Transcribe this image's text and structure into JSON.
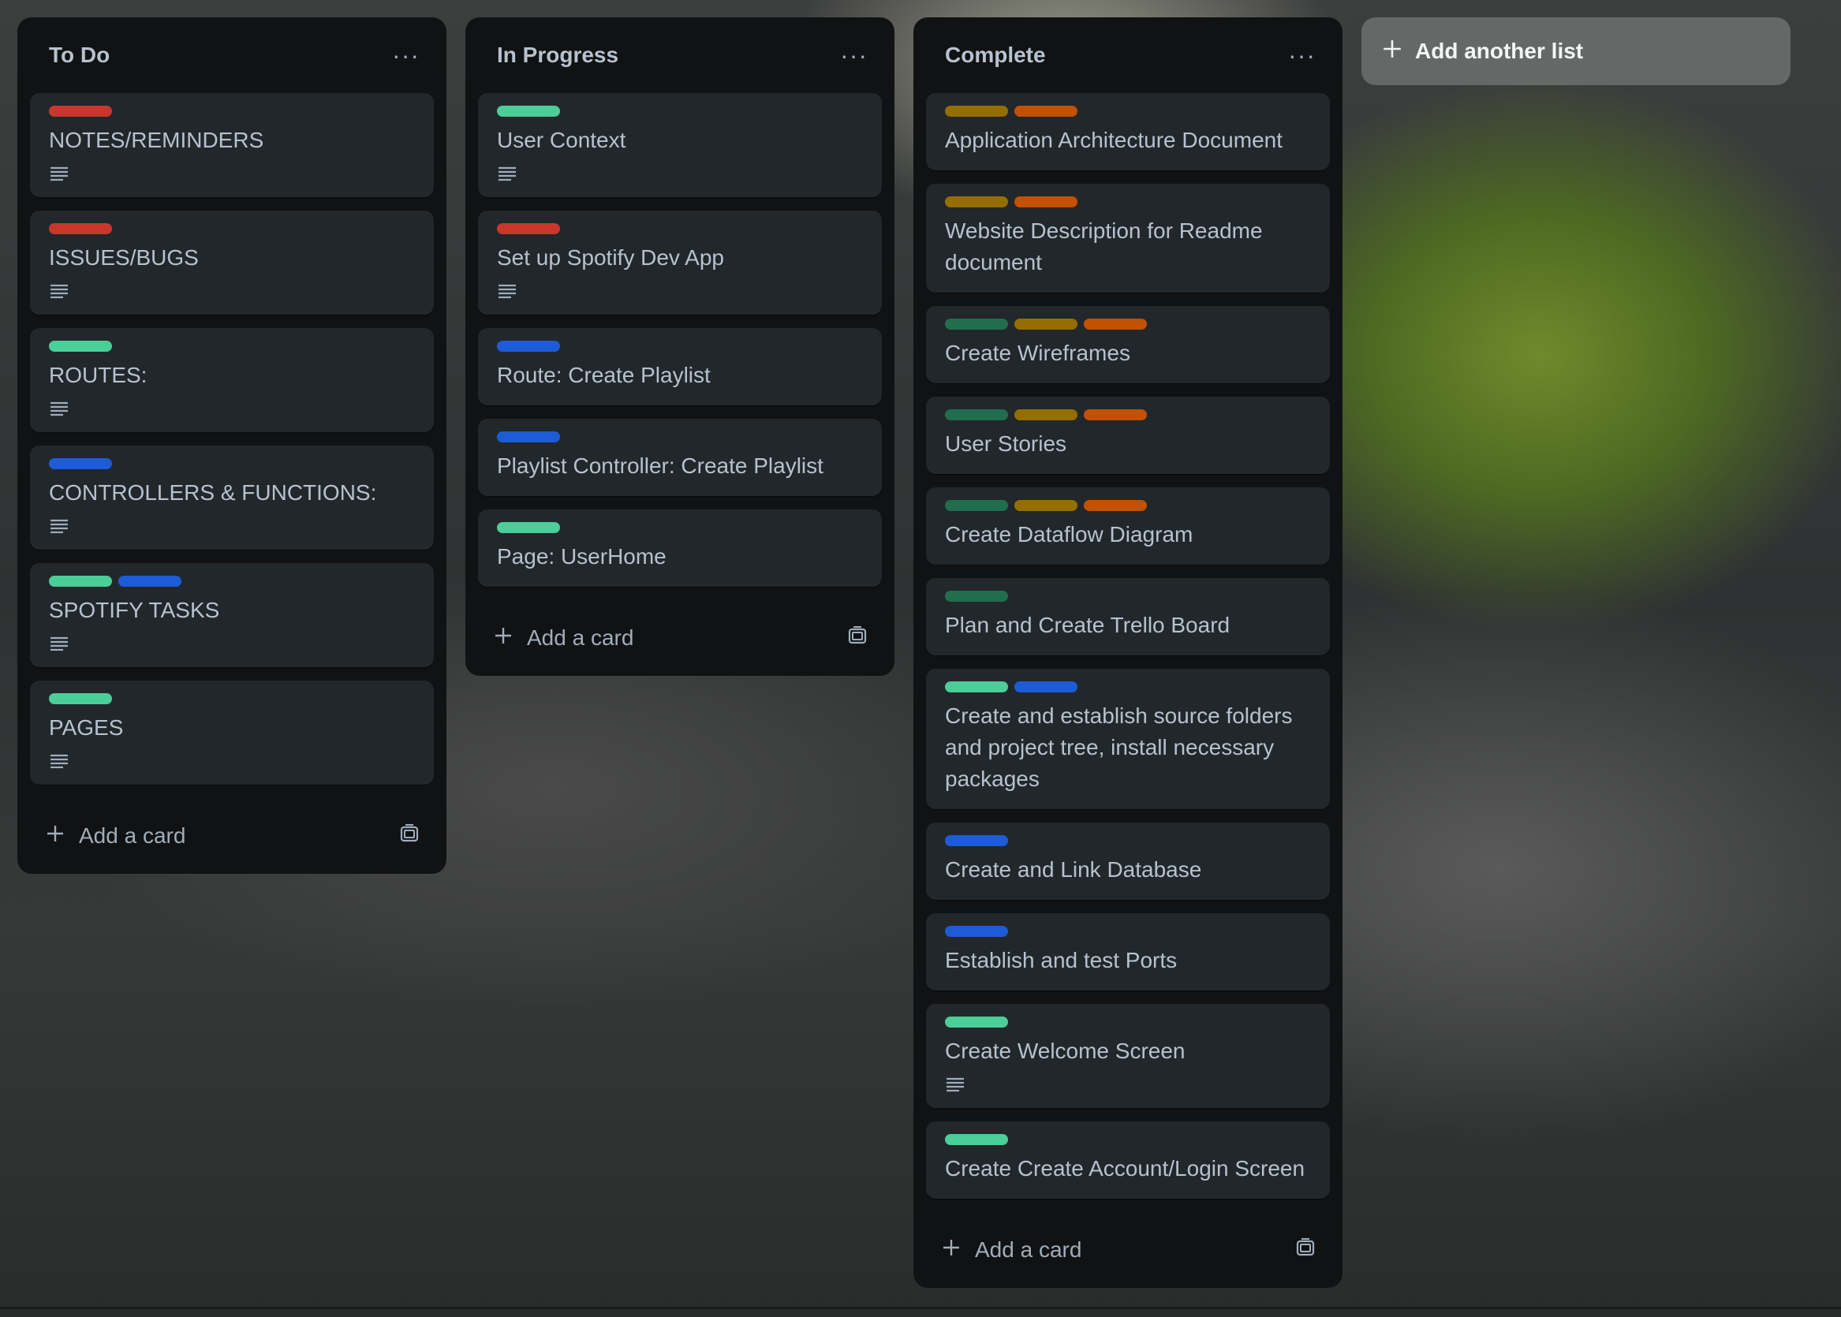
{
  "colors": {
    "red": "#c9372c",
    "green": "#4bce97",
    "blue": "#1d5cd6",
    "olive": "#946f00",
    "orange": "#c25100",
    "darkgreen": "#216e4e"
  },
  "lists": [
    {
      "title": "To Do",
      "menu_icon": "more-icon",
      "cards": [
        {
          "labels": [
            "red"
          ],
          "title": "NOTES/REMINDERS",
          "description_icon": true
        },
        {
          "labels": [
            "red"
          ],
          "title": "ISSUES/BUGS",
          "description_icon": true
        },
        {
          "labels": [
            "green"
          ],
          "title": "ROUTES:",
          "description_icon": true
        },
        {
          "labels": [
            "blue"
          ],
          "title": "CONTROLLERS & FUNCTIONS:",
          "description_icon": true
        },
        {
          "labels": [
            "green",
            "blue"
          ],
          "title": "SPOTIFY TASKS",
          "description_icon": true
        },
        {
          "labels": [
            "green"
          ],
          "title": "PAGES",
          "description_icon": true
        }
      ],
      "add_card_label": "Add a card"
    },
    {
      "title": "In Progress",
      "menu_icon": "more-icon",
      "cards": [
        {
          "labels": [
            "green"
          ],
          "title": "User Context",
          "description_icon": true
        },
        {
          "labels": [
            "red"
          ],
          "title": "Set up Spotify Dev App",
          "description_icon": true
        },
        {
          "labels": [
            "blue"
          ],
          "title": "Route: Create Playlist",
          "description_icon": false
        },
        {
          "labels": [
            "blue"
          ],
          "title": "Playlist Controller: Create Playlist",
          "description_icon": false
        },
        {
          "labels": [
            "green"
          ],
          "title": "Page: UserHome",
          "description_icon": false
        }
      ],
      "add_card_label": "Add a card"
    },
    {
      "title": "Complete",
      "menu_icon": "more-icon",
      "cards": [
        {
          "labels": [
            "olive",
            "orange"
          ],
          "title": "Application Architecture Document",
          "description_icon": false
        },
        {
          "labels": [
            "olive",
            "orange"
          ],
          "title": "Website Description for Readme document",
          "description_icon": false
        },
        {
          "labels": [
            "darkgreen",
            "olive",
            "orange"
          ],
          "title": "Create Wireframes",
          "description_icon": false
        },
        {
          "labels": [
            "darkgreen",
            "olive",
            "orange"
          ],
          "title": "User Stories",
          "description_icon": false
        },
        {
          "labels": [
            "darkgreen",
            "olive",
            "orange"
          ],
          "title": "Create Dataflow Diagram",
          "description_icon": false
        },
        {
          "labels": [
            "darkgreen"
          ],
          "title": "Plan and Create Trello Board",
          "description_icon": false
        },
        {
          "labels": [
            "green",
            "blue"
          ],
          "title": "Create and establish source folders and project tree, install necessary packages",
          "description_icon": false
        },
        {
          "labels": [
            "blue"
          ],
          "title": "Create and Link Database",
          "description_icon": false
        },
        {
          "labels": [
            "blue"
          ],
          "title": "Establish and test Ports",
          "description_icon": false
        },
        {
          "labels": [
            "green"
          ],
          "title": "Create Welcome Screen",
          "description_icon": true
        },
        {
          "labels": [
            "green"
          ],
          "title": "Create Create Account/Login Screen",
          "description_icon": false
        }
      ],
      "add_card_label": "Add a card"
    }
  ],
  "add_list_label": "Add another list"
}
